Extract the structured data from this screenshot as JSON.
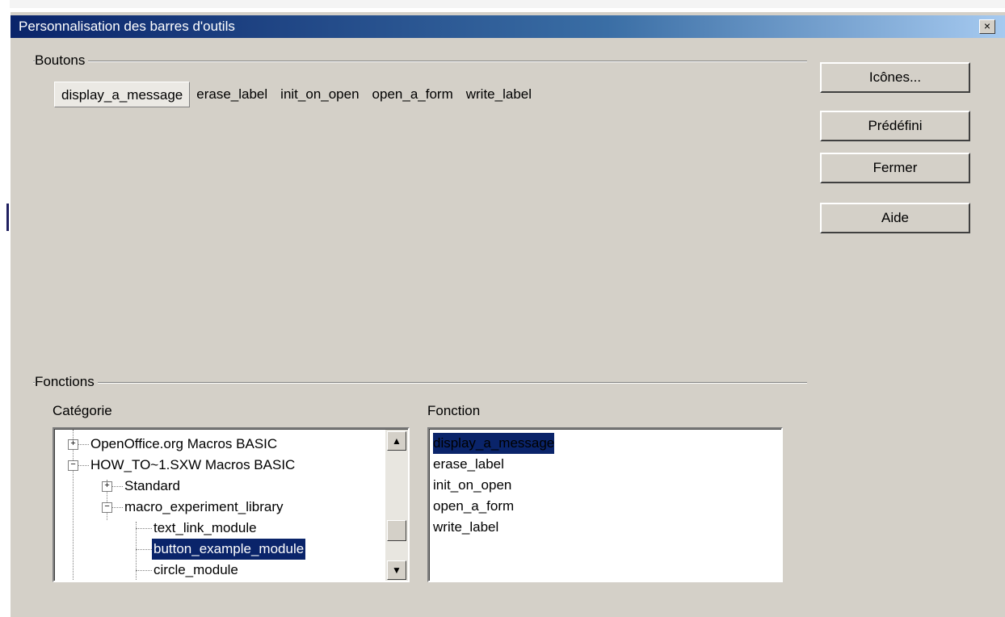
{
  "window": {
    "title": "Personnalisation des barres d'outils",
    "close_glyph": "×"
  },
  "boutons_group": {
    "label": "Boutons",
    "items": [
      "display_a_message",
      "erase_label",
      "init_on_open",
      "open_a_form",
      "write_label"
    ],
    "selected_index": 0
  },
  "side_buttons": {
    "icones": "Icônes...",
    "predefini": "Prédéfini",
    "fermer": "Fermer",
    "aide": "Aide"
  },
  "fonctions_group": {
    "label": "Fonctions",
    "categorie_label": "Catégorie",
    "fonction_label": "Fonction",
    "tree": [
      {
        "label": "OpenOffice.org Macros BASIC",
        "expander": "+"
      },
      {
        "label": "HOW_TO~1.SXW Macros BASIC",
        "expander": "−"
      },
      {
        "label": "Standard",
        "expander": "+"
      },
      {
        "label": "macro_experiment_library",
        "expander": "−"
      },
      {
        "label": "text_link_module",
        "expander": ""
      },
      {
        "label": "button_example_module",
        "expander": "",
        "selected": true
      },
      {
        "label": "circle_module",
        "expander": ""
      }
    ],
    "functions": [
      "display_a_message",
      "erase_label",
      "init_on_open",
      "open_a_form",
      "write_label"
    ],
    "selected_function_index": 0
  },
  "scroll_icons": {
    "up": "▲",
    "down": "▼"
  }
}
